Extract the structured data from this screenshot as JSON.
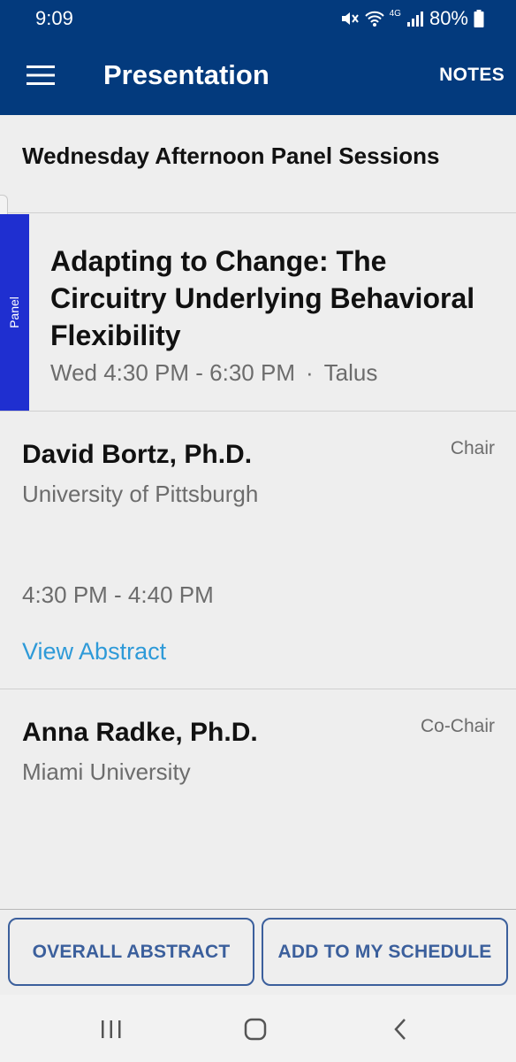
{
  "status_bar": {
    "time": "9:09",
    "network": "4G",
    "battery": "80%",
    "icons": [
      "mute-icon",
      "wifi-icon",
      "signal-icon",
      "battery-icon"
    ]
  },
  "app_bar": {
    "title": "Presentation",
    "notes_label": "NOTES",
    "menu_icon": "hamburger-menu-icon"
  },
  "section": {
    "title": "Wednesday Afternoon Panel Sessions"
  },
  "session": {
    "type_label": "Panel",
    "stripe_color": "#1f2fd0",
    "title": "Adapting to Change: The Circuitry Underlying Behavioral Flexibility",
    "time": "Wed 4:30 PM - 6:30 PM",
    "separator": "·",
    "location": "Talus"
  },
  "speakers": [
    {
      "name": "David Bortz, Ph.D.",
      "role": "Chair",
      "affiliation": "University of Pittsburgh",
      "time": "4:30 PM - 4:40 PM",
      "link_label": "View Abstract"
    },
    {
      "name": "Anna Radke, Ph.D.",
      "role": "Co-Chair",
      "affiliation": "Miami University"
    }
  ],
  "actions": {
    "overall_abstract": "OVERALL ABSTRACT",
    "add_schedule": "ADD TO MY SCHEDULE"
  },
  "nav_bar": {
    "icons": [
      "recent-apps-icon",
      "home-icon",
      "back-icon"
    ]
  },
  "colors": {
    "header": "#033a7d",
    "link": "#2e9ad8",
    "button_outline": "#3b5f9c"
  }
}
